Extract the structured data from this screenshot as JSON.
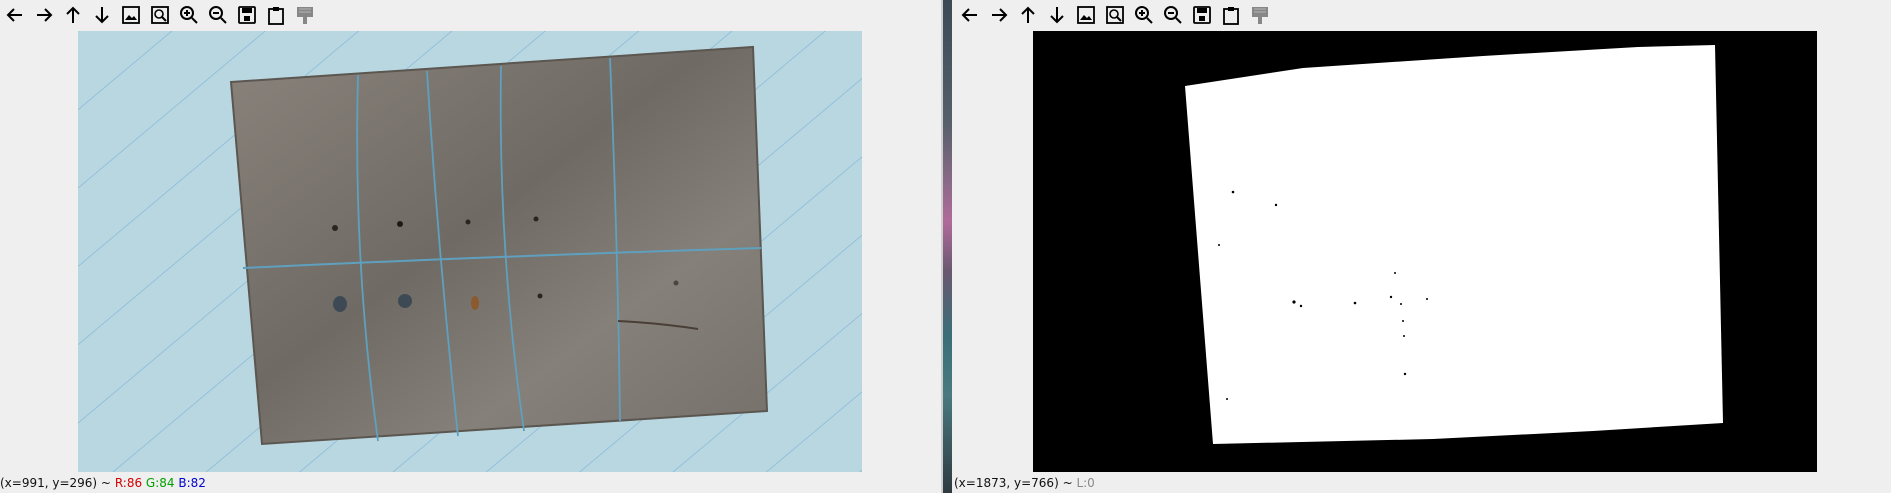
{
  "toolbar_icons": [
    "arrow-left-icon",
    "arrow-right-icon",
    "arrow-up-icon",
    "arrow-down-icon",
    "picture-icon",
    "zoom-region-icon",
    "zoom-in-icon",
    "zoom-out-icon",
    "save-icon",
    "clipboard-icon",
    "properties-icon"
  ],
  "left_window": {
    "status_coords": "(x=991, y=296) ~",
    "status_r": "R:86",
    "status_g": "G:84",
    "status_b": "B:82"
  },
  "right_window": {
    "status_coords": "(x=1873, y=766) ~",
    "status_l": "L:0"
  },
  "colors": {
    "background": "#efefef",
    "paper": "#b9d7e1",
    "metal": "#7d7770",
    "mask_white": "#ffffff",
    "mask_black": "#000000",
    "status_red": "#d00000",
    "status_green": "#00a000",
    "status_blue": "#0000d0",
    "status_gray": "#8a8a8a"
  }
}
